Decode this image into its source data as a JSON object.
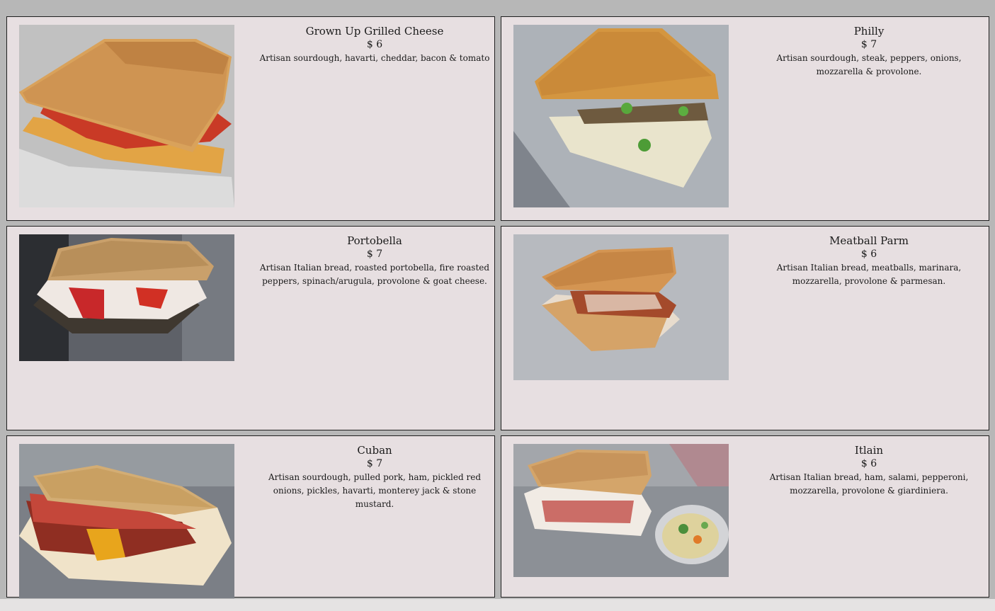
{
  "menu": {
    "items": [
      {
        "title": "Grown Up Grilled Cheese",
        "price": "$ 6",
        "description": "Artisan sourdough, havarti, cheddar, bacon & tomato",
        "photo_alt": "grilled cheese sandwich photo"
      },
      {
        "title": "Philly",
        "price": "$ 7",
        "description": "Artisan sourdough, steak, peppers, onions, mozzarella & provolone.",
        "photo_alt": "philly sandwich photo"
      },
      {
        "title": "Portobella",
        "price": "$ 7",
        "description": "Artisan Italian bread, roasted portobella, fire roasted peppers, spinach/arugula, provolone & goat cheese.",
        "photo_alt": "portobella sandwich photo"
      },
      {
        "title": "Meatball Parm",
        "price": "$ 6",
        "description": "Artisan Italian bread, meatballs, marinara, mozzarella, provolone & parmesan.",
        "photo_alt": "meatball parm sandwich photo"
      },
      {
        "title": "Cuban",
        "price": "$ 7",
        "description": "Artisan sourdough, pulled pork, ham, pickled red onions, pickles, havarti, monterey jack & stone mustard.",
        "photo_alt": "cuban sandwich photo"
      },
      {
        "title": "Itlain",
        "price": "$ 6",
        "description": "Artisan Italian bread, ham, salami, pepperoni, mozzarella, provolone & giardiniera.",
        "photo_alt": "italian sandwich photo"
      }
    ]
  },
  "colors": {
    "page_background": "#b7b7b7",
    "card_background": "#e7dfe1",
    "card_border": "#1f1f1f",
    "text": "#1a1a1a"
  }
}
